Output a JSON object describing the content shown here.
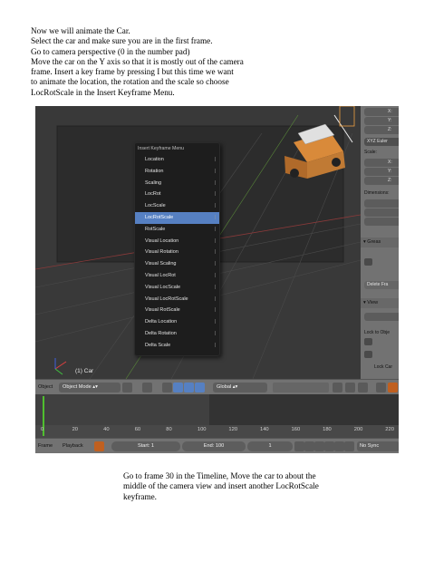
{
  "intro_lines": [
    "Now we will animate the Car.",
    "Select the car and make sure you are in the first frame.",
    "Go to camera perspective (0 in the number pad)",
    "Move the car on the Y axis so that it is mostly out of the camera",
    "frame. Insert a key frame by pressing I but this time we want",
    "to animate the location, the rotation and the scale so choose",
    "LocRotScale in the Insert Keyframe Menu."
  ],
  "outro_lines": [
    "Go to frame 30 in the Timeline, Move the car to about the",
    "middle of the camera view and insert another LocRotScale",
    "keyframe."
  ],
  "viewport": {
    "object_label": "(1) Car"
  },
  "menu": {
    "title": "Insert Keyframe Menu",
    "selected": "LocRotScale",
    "items": [
      "Location",
      "Rotation",
      "Scaling",
      "LocRot",
      "LocScale",
      "LocRotScale",
      "RotScale",
      "Visual Location",
      "Visual Rotation",
      "Visual Scaling",
      "Visual LocRot",
      "Visual LocScale",
      "Visual LocRotScale",
      "Visual RotScale",
      "Delta Location",
      "Delta Rotation",
      "Delta Scale"
    ]
  },
  "properties": {
    "x_label": "X:",
    "y_label": "Y:",
    "z_label": "Z:",
    "rotation_mode": "XYZ Euler",
    "scale_label": "Scale:",
    "dimensions_label": "Dimensions:",
    "grease_label": "Greas",
    "delete_label": "Delete Fra",
    "view_label": "View",
    "lock_label": "Lock to Obje",
    "lock_cam_label": "Lock Car"
  },
  "header": {
    "object_menu": "Object",
    "mode": "Object Mode",
    "orientation": "Global"
  },
  "timeline": {
    "ticks": [
      "0",
      "20",
      "40",
      "60",
      "80",
      "100",
      "120",
      "140",
      "160",
      "180",
      "200",
      "220"
    ],
    "current_frame": "1"
  },
  "footer": {
    "frame_label": "Frame",
    "playback_label": "Playback",
    "start": "Start: 1",
    "end": "End: 100",
    "frame_value": "1",
    "sync": "No Sync"
  },
  "colors": {
    "menu_highlight": "#5680c2",
    "cursor": "#4fbf2e"
  }
}
